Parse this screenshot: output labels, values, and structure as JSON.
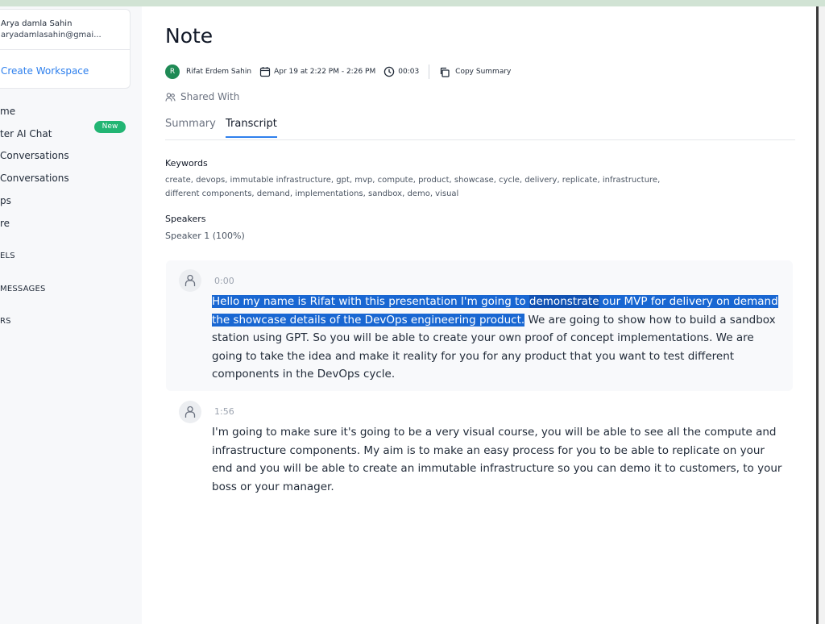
{
  "workspace": {
    "name": "Arya damla Sahin",
    "email": "aryadamlasahin@gmai...",
    "create_label": "Create Workspace"
  },
  "sidebar": {
    "items": [
      {
        "label": "me"
      },
      {
        "label": "ter AI Chat",
        "badge": "New"
      },
      {
        "label": " Conversations"
      },
      {
        "label": " Conversations"
      },
      {
        "label": "ps"
      },
      {
        "label": "re"
      }
    ],
    "sections": [
      "ELS",
      "MESSAGES",
      "RS"
    ]
  },
  "note": {
    "title": "Note",
    "owner_initial": "R",
    "owner_name": "Rifat Erdem Sahin",
    "date": "Apr 19 at 2:22 PM - 2:26 PM",
    "duration": "00:03",
    "copy_label": "Copy Summary",
    "shared_label": "Shared With"
  },
  "tabs": [
    {
      "label": "Summary",
      "active": false
    },
    {
      "label": "Transcript",
      "active": true
    }
  ],
  "keywords": {
    "label": "Keywords",
    "line1": "create, devops, immutable infrastructure, gpt, mvp, compute, product, showcase, cycle, delivery, replicate, infrastructure,",
    "line2": "different components, demand, implementations, sandbox, demo, visual"
  },
  "speakers": {
    "label": "Speakers",
    "value": "Speaker 1 (100%)"
  },
  "transcript": [
    {
      "time": "0:00",
      "part_a": "Hello my name is Rifat with this presentation I'm going to ",
      "part_b": "demonstrate",
      "part_c": " our MVP for delivery on demand",
      "part_d": "the showcase details of the DevOps engineering product.",
      "part_e": " We are going to show how to build a sandbox station using GPT. So you will be able to create your own proof of concept implementations. We are going to take the idea and make it reality for you for any product that you want to test different components in the DevOps cycle."
    },
    {
      "time": "1:56",
      "text": "I'm going to make sure it's going to be a very visual course, you will be able to see all the compute and infrastructure components. My aim is to make an easy process for you to be able to replicate on your end and you will be able to create an immutable infrastructure so you can demo it to customers, to your boss or your manager."
    }
  ],
  "colors": {
    "accent": "#2f80ed",
    "badge": "#22b573",
    "avatar": "#1f8a55",
    "selection": "#1967d2"
  }
}
